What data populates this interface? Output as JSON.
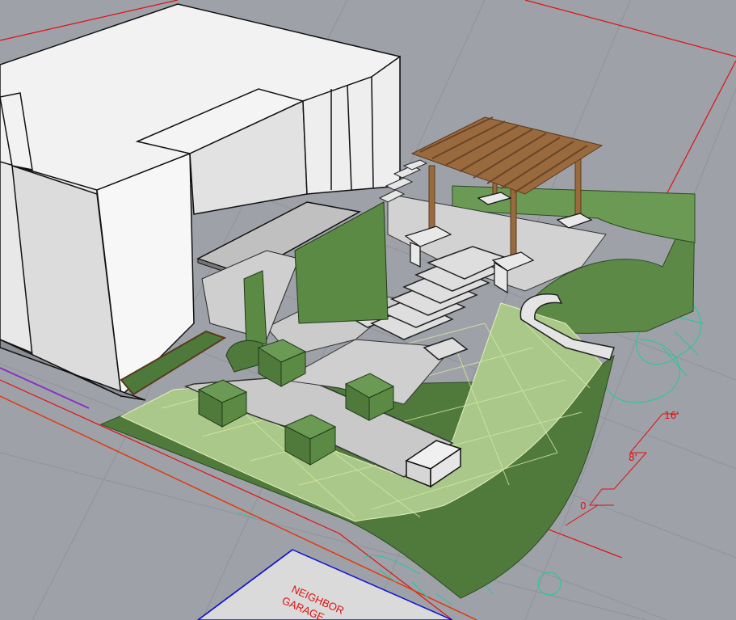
{
  "viewport": {
    "background_color": "#9ea2a8"
  },
  "dimensions": {
    "label_16": "16'",
    "label_8": "8'",
    "label_0": "0"
  },
  "neighbor": {
    "label_line1": "NEIGHBOR",
    "label_line2": "GARAGE"
  },
  "colors": {
    "property_line": "#e01010",
    "curb_line": "#e03a10",
    "neighbor_outline": "#1010d0",
    "planting_outline": "#20c8a0",
    "lawn_dark": "#4f7a3c",
    "lawn_light": "#a9c88a",
    "hedge": "#5a8a44",
    "building_wall": "#f2f2f2",
    "building_shade": "#d9d9d9",
    "paving": "#c9c9c9",
    "pergola_wood": "#9a6a3f"
  }
}
